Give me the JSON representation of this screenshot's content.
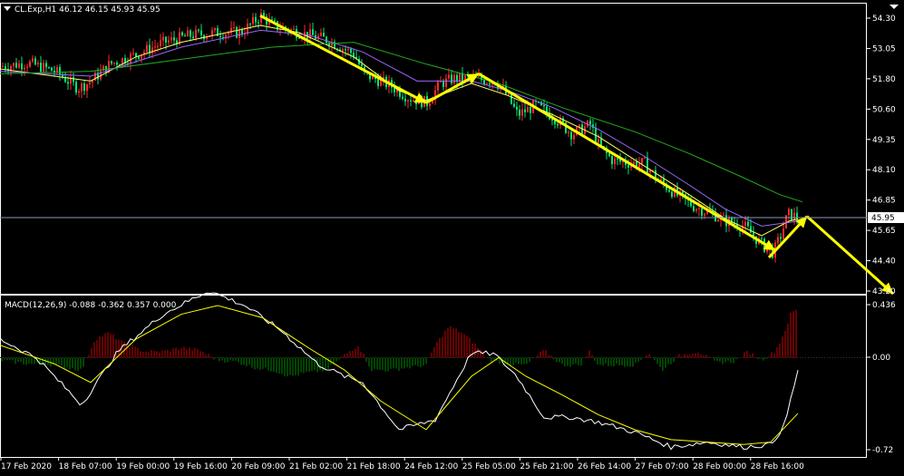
{
  "price_panel": {
    "title": "CL.Exp,H1  46.12 46.15 45.93 45.95",
    "current_price_label": "45.95",
    "y_ticks": [
      "54.30",
      "53.05",
      "51.80",
      "50.60",
      "49.35",
      "48.10",
      "46.85",
      "45.65",
      "44.40",
      "43.20"
    ]
  },
  "macd_panel": {
    "title": "MACD(12,26,9) -0.088 -0.362 0.357 0.000",
    "y_ticks": [
      "0.436",
      "0.00",
      "-0.72"
    ]
  },
  "x_ticks": [
    "17 Feb 2020",
    "18 Feb 07:00",
    "19 Feb 00:00",
    "19 Feb 16:00",
    "20 Feb 09:00",
    "21 Feb 02:00",
    "21 Feb 18:00",
    "24 Feb 12:00",
    "25 Feb 05:00",
    "25 Feb 21:00",
    "26 Feb 14:00",
    "27 Feb 07:00",
    "28 Feb 00:00",
    "28 Feb 16:00"
  ],
  "colors": {
    "background": "#000000",
    "axis": "#ffffff",
    "bull": "#ff2a2a",
    "bear": "#00e676",
    "ma_fast": "#ffff66",
    "ma_mid": "#9966ff",
    "ma_slow": "#22aa22",
    "arrow": "#ffff00",
    "price_line": "#8899bb",
    "macd_main": "#ffffff",
    "macd_signal": "#ffff00",
    "hist_pos": "#cc0000",
    "hist_neg": "#008800"
  },
  "chart_data": [
    {
      "type": "candlestick",
      "symbol": "CL.Exp",
      "timeframe": "H1",
      "ylim": [
        42.8,
        54.8
      ],
      "last_price": 45.95,
      "close_path": [
        [
          0,
          52.2
        ],
        [
          30,
          52.35
        ],
        [
          60,
          52.0
        ],
        [
          85,
          51.3
        ],
        [
          100,
          51.6
        ],
        [
          120,
          52.3
        ],
        [
          150,
          52.7
        ],
        [
          180,
          53.2
        ],
        [
          210,
          53.5
        ],
        [
          240,
          53.6
        ],
        [
          265,
          53.6
        ],
        [
          287,
          54.3
        ],
        [
          300,
          53.9
        ],
        [
          330,
          53.6
        ],
        [
          360,
          53.3
        ],
        [
          390,
          52.7
        ],
        [
          400,
          51.9
        ],
        [
          430,
          51.4
        ],
        [
          450,
          50.9
        ],
        [
          470,
          50.7
        ],
        [
          485,
          51.5
        ],
        [
          500,
          51.7
        ],
        [
          520,
          51.7
        ],
        [
          545,
          51.6
        ],
        [
          555,
          51.2
        ],
        [
          570,
          50.2
        ],
        [
          590,
          50.6
        ],
        [
          610,
          50.1
        ],
        [
          630,
          49.4
        ],
        [
          650,
          49.8
        ],
        [
          660,
          48.9
        ],
        [
          675,
          48.3
        ],
        [
          695,
          48.2
        ],
        [
          710,
          48.2
        ],
        [
          725,
          47.5
        ],
        [
          745,
          46.9
        ],
        [
          765,
          46.4
        ],
        [
          785,
          46.1
        ],
        [
          800,
          45.8
        ],
        [
          820,
          45.6
        ],
        [
          840,
          44.8
        ],
        [
          852,
          44.5
        ],
        [
          860,
          45.2
        ],
        [
          868,
          46.1
        ],
        [
          880,
          45.95
        ]
      ],
      "moving_averages": [
        {
          "color": "ma_fast",
          "path": [
            [
              0,
              52.1
            ],
            [
              100,
              51.6
            ],
            [
              150,
              52.6
            ],
            [
              200,
              53.2
            ],
            [
              287,
              53.9
            ],
            [
              330,
              53.6
            ],
            [
              390,
              52.6
            ],
            [
              440,
              51.2
            ],
            [
              470,
              50.8
            ],
            [
              520,
              51.5
            ],
            [
              560,
              51.0
            ],
            [
              610,
              50.2
            ],
            [
              660,
              49.3
            ],
            [
              710,
              48.1
            ],
            [
              760,
              46.9
            ],
            [
              800,
              45.9
            ],
            [
              840,
              45.2
            ],
            [
              870,
              45.8
            ],
            [
              880,
              45.9
            ]
          ]
        },
        {
          "color": "ma_mid",
          "path": [
            [
              0,
              52.0
            ],
            [
              100,
              51.8
            ],
            [
              150,
              52.4
            ],
            [
              200,
              53.0
            ],
            [
              287,
              53.7
            ],
            [
              340,
              53.5
            ],
            [
              400,
              52.8
            ],
            [
              460,
              51.6
            ],
            [
              520,
              51.6
            ],
            [
              560,
              51.2
            ],
            [
              610,
              50.5
            ],
            [
              660,
              49.6
            ],
            [
              710,
              48.5
            ],
            [
              760,
              47.3
            ],
            [
              800,
              46.3
            ],
            [
              840,
              45.6
            ],
            [
              880,
              45.8
            ]
          ]
        },
        {
          "color": "ma_slow",
          "path": [
            [
              0,
              51.9
            ],
            [
              100,
              52.0
            ],
            [
              200,
              52.5
            ],
            [
              300,
              53.0
            ],
            [
              390,
              53.2
            ],
            [
              470,
              52.3
            ],
            [
              550,
              51.5
            ],
            [
              620,
              50.5
            ],
            [
              700,
              49.5
            ],
            [
              760,
              48.6
            ],
            [
              820,
              47.6
            ],
            [
              860,
              46.9
            ],
            [
              885,
              46.6
            ]
          ]
        }
      ],
      "trend_arrows": [
        [
          [
            287,
            54.3
          ],
          [
            470,
            50.7
          ]
        ],
        [
          [
            470,
            50.7
          ],
          [
            528,
            51.9
          ]
        ],
        [
          [
            528,
            51.9
          ],
          [
            855,
            44.6
          ]
        ],
        [
          [
            848,
            44.3
          ],
          [
            890,
            46.0
          ]
        ],
        [
          [
            890,
            46.0
          ],
          [
            985,
            42.8
          ]
        ]
      ]
    },
    {
      "type": "macd",
      "params": [
        12,
        26,
        9
      ],
      "main": -0.088,
      "signal": -0.362,
      "histogram": 0.357,
      "level": 0.0,
      "ylim": [
        -0.8,
        0.5
      ],
      "main_path": [
        [
          0,
          0.15
        ],
        [
          40,
          0.0
        ],
        [
          90,
          -0.38
        ],
        [
          130,
          0.05
        ],
        [
          180,
          0.35
        ],
        [
          230,
          0.54
        ],
        [
          270,
          0.42
        ],
        [
          310,
          0.22
        ],
        [
          350,
          -0.05
        ],
        [
          380,
          -0.15
        ],
        [
          400,
          -0.2
        ],
        [
          440,
          -0.58
        ],
        [
          480,
          -0.5
        ],
        [
          520,
          0.04
        ],
        [
          545,
          0.03
        ],
        [
          570,
          -0.15
        ],
        [
          600,
          -0.48
        ],
        [
          630,
          -0.48
        ],
        [
          660,
          -0.52
        ],
        [
          700,
          -0.6
        ],
        [
          740,
          -0.72
        ],
        [
          780,
          -0.68
        ],
        [
          820,
          -0.72
        ],
        [
          850,
          -0.7
        ],
        [
          865,
          -0.55
        ],
        [
          880,
          -0.1
        ]
      ],
      "signal_path": [
        [
          0,
          0.1
        ],
        [
          60,
          -0.05
        ],
        [
          100,
          -0.2
        ],
        [
          150,
          0.15
        ],
        [
          200,
          0.35
        ],
        [
          240,
          0.42
        ],
        [
          290,
          0.32
        ],
        [
          340,
          0.08
        ],
        [
          380,
          -0.1
        ],
        [
          420,
          -0.35
        ],
        [
          470,
          -0.58
        ],
        [
          520,
          -0.15
        ],
        [
          550,
          0.0
        ],
        [
          580,
          -0.15
        ],
        [
          620,
          -0.3
        ],
        [
          660,
          -0.46
        ],
        [
          700,
          -0.58
        ],
        [
          740,
          -0.66
        ],
        [
          780,
          -0.68
        ],
        [
          820,
          -0.7
        ],
        [
          850,
          -0.68
        ],
        [
          880,
          -0.45
        ]
      ],
      "histogram_path": [
        [
          0,
          -0.02
        ],
        [
          30,
          -0.05
        ],
        [
          60,
          -0.06
        ],
        [
          90,
          -0.1
        ],
        [
          105,
          0.15
        ],
        [
          120,
          0.2
        ],
        [
          140,
          0.1
        ],
        [
          160,
          0.05
        ],
        [
          180,
          0.05
        ],
        [
          200,
          0.08
        ],
        [
          220,
          0.06
        ],
        [
          240,
          -0.02
        ],
        [
          260,
          -0.03
        ],
        [
          280,
          -0.08
        ],
        [
          300,
          -0.1
        ],
        [
          320,
          -0.15
        ],
        [
          340,
          -0.12
        ],
        [
          360,
          -0.1
        ],
        [
          380,
          0.02
        ],
        [
          395,
          0.1
        ],
        [
          410,
          -0.1
        ],
        [
          430,
          -0.1
        ],
        [
          450,
          -0.08
        ],
        [
          470,
          -0.06
        ],
        [
          480,
          0.1
        ],
        [
          495,
          0.25
        ],
        [
          510,
          0.2
        ],
        [
          525,
          0.1
        ],
        [
          540,
          -0.02
        ],
        [
          560,
          -0.05
        ],
        [
          580,
          -0.06
        ],
        [
          600,
          0.06
        ],
        [
          620,
          -0.06
        ],
        [
          640,
          -0.06
        ],
        [
          650,
          0.05
        ],
        [
          660,
          -0.06
        ],
        [
          680,
          -0.06
        ],
        [
          700,
          -0.06
        ],
        [
          715,
          0.04
        ],
        [
          730,
          -0.1
        ],
        [
          750,
          0.02
        ],
        [
          770,
          0.05
        ],
        [
          790,
          -0.04
        ],
        [
          810,
          -0.03
        ],
        [
          825,
          0.05
        ],
        [
          840,
          -0.02
        ],
        [
          855,
          0.05
        ],
        [
          865,
          0.2
        ],
        [
          872,
          0.35
        ],
        [
          880,
          0.4
        ]
      ]
    }
  ]
}
